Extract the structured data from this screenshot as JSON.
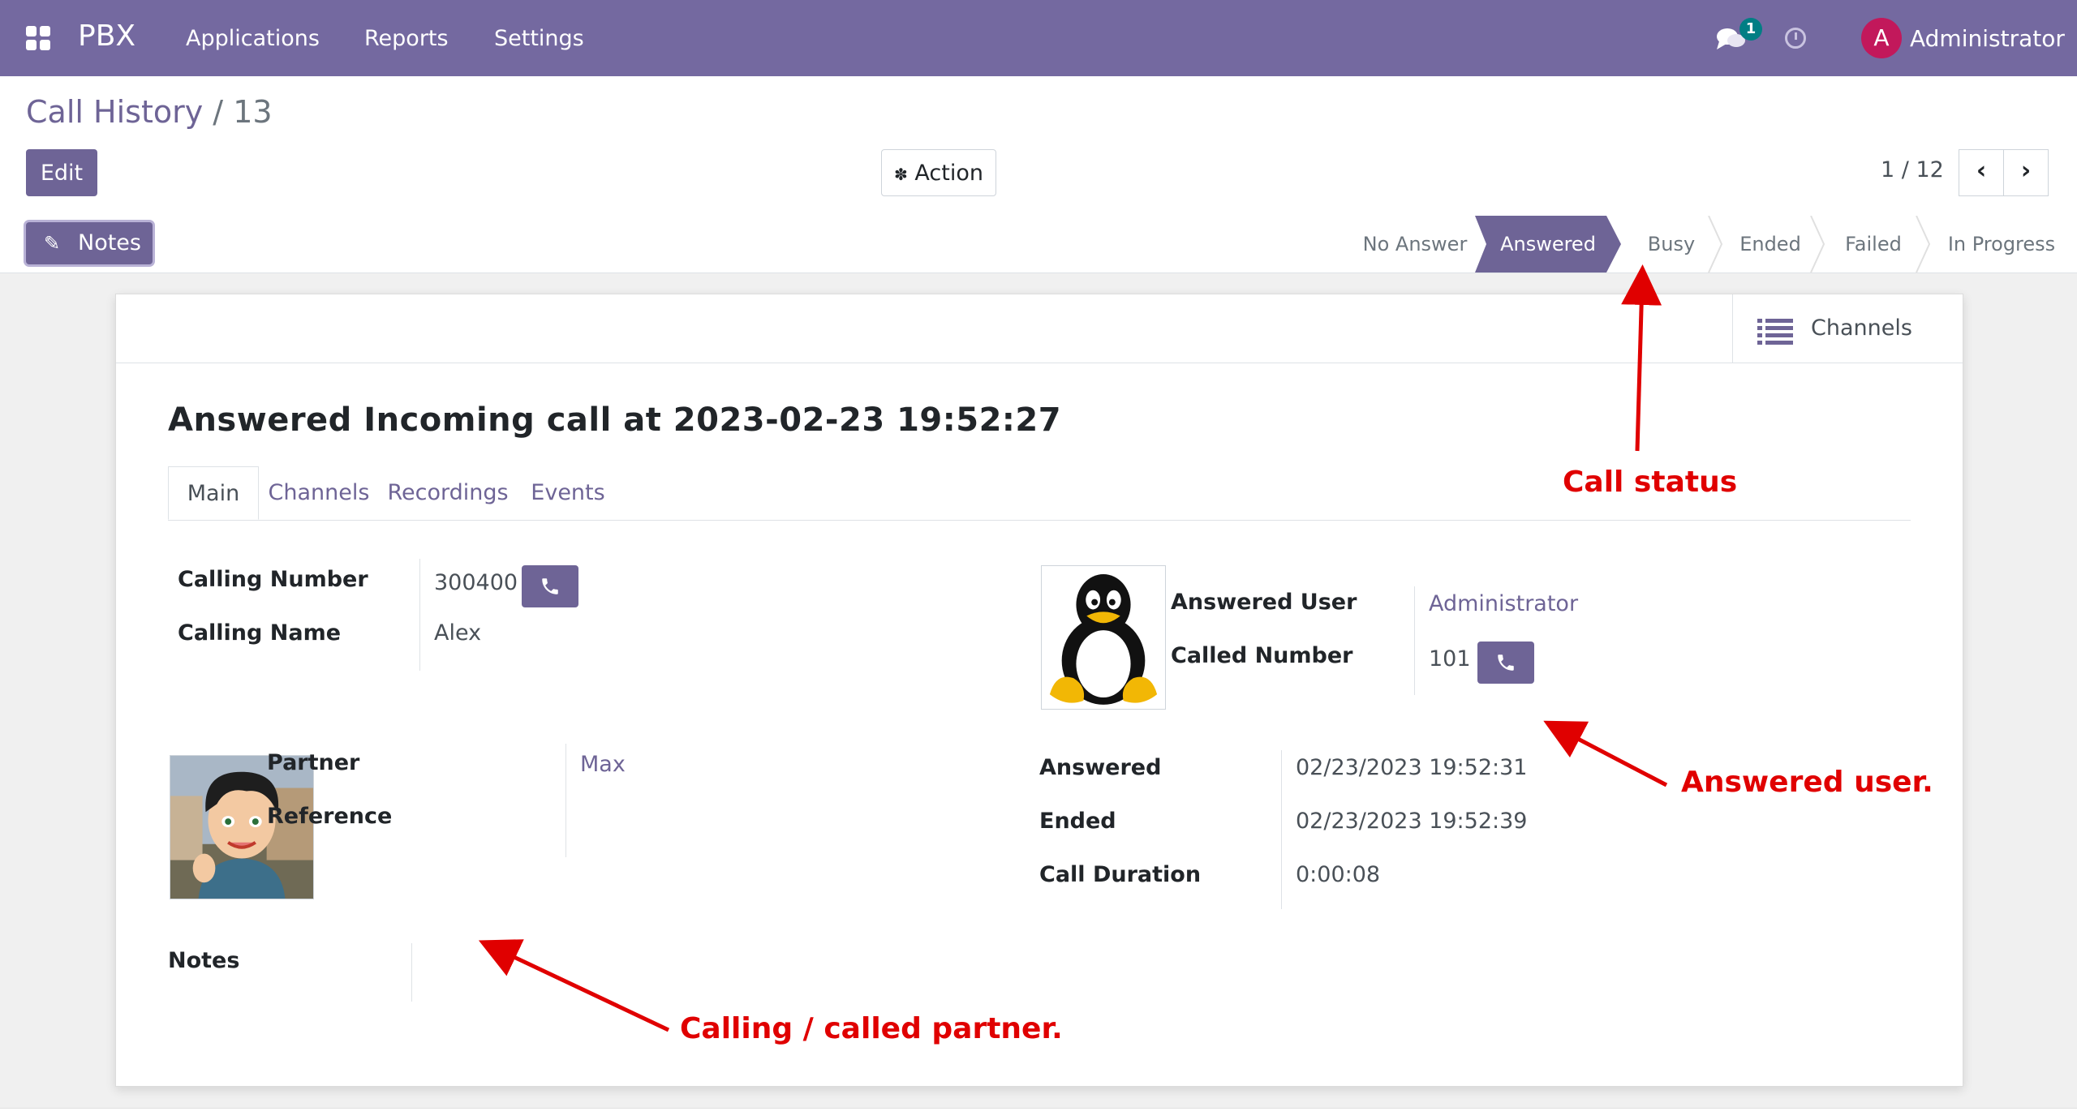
{
  "navbar": {
    "brand": "PBX",
    "menu": [
      "Applications",
      "Reports",
      "Settings"
    ],
    "chat_count": "1",
    "avatar_letter": "A",
    "user_name": "Administrator"
  },
  "breadcrumb": {
    "parent": "Call History",
    "separator": "/",
    "current": "13"
  },
  "buttons": {
    "edit": "Edit",
    "action": "Action",
    "notes": "Notes"
  },
  "pager": {
    "text": "1 / 12"
  },
  "statusbar": {
    "stages": [
      "No Answer",
      "Answered",
      "Busy",
      "Ended",
      "Failed",
      "In Progress"
    ],
    "active": "Answered"
  },
  "smart_button": {
    "label": "Channels",
    "icon": "list-icon"
  },
  "record": {
    "title": "Answered Incoming call at 2023-02-23 19:52:27",
    "tabs": [
      "Main",
      "Channels",
      "Recordings",
      "Events"
    ],
    "active_tab": "Main",
    "calling_number_label": "Calling Number",
    "calling_number": "300400",
    "calling_name_label": "Calling Name",
    "calling_name": "Alex",
    "partner_label": "Partner",
    "partner": "Max",
    "reference_label": "Reference",
    "reference": "",
    "notes_label": "Notes",
    "answered_user_label": "Answered User",
    "answered_user": "Administrator",
    "called_number_label": "Called Number",
    "called_number": "101",
    "answered_label": "Answered",
    "answered": "02/23/2023 19:52:31",
    "ended_label": "Ended",
    "ended": "02/23/2023 19:52:39",
    "duration_label": "Call Duration",
    "duration": "0:00:08"
  },
  "annotations": {
    "call_status": "Call status",
    "answered_user": "Answered user.",
    "partner": "Calling / called partner."
  },
  "colors": {
    "navbar": "#7469a0",
    "primary": "#6e6496",
    "annotation": "#e00000"
  }
}
